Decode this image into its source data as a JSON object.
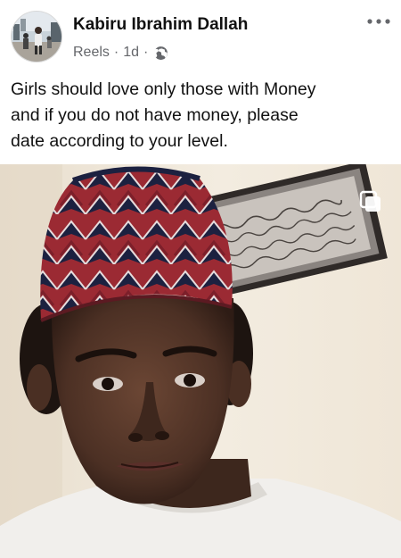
{
  "post": {
    "author": {
      "name": "Kabiru Ibrahim Dallah"
    },
    "meta": {
      "source": "Reels",
      "separator": "·",
      "time": "1d",
      "audience_icon": "globe-icon"
    },
    "menu_icon": "more-options-icon",
    "caption_lines": [
      "Girls should love only those with Money",
      "and if you do not have money, please",
      "date according to your level."
    ],
    "media": {
      "type": "video-still",
      "overlay_icon": "reels-icon"
    }
  }
}
